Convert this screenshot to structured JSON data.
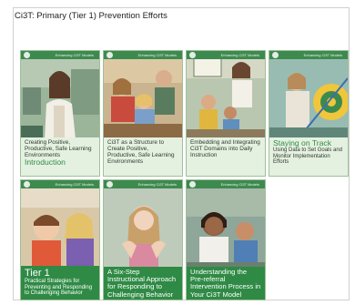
{
  "page": {
    "title": "Ci3T: Primary (Tier 1) Prevention Efforts",
    "brand": "Enhancing Ci3T Models"
  },
  "cards": [
    {
      "title": "Creating Positive, Productive, Safe Learning Environments",
      "subtitle": "Introduction"
    },
    {
      "title": "Ci3T as a Structure to Create Positive, Productive, Safe Learning Environments"
    },
    {
      "title": "Embedding and Integrating Ci3T Domains into Daily Instruction"
    },
    {
      "heading": "Staying on Track",
      "subtitle": "Using Data to Set Goals and Monitor Implementation Efforts"
    },
    {
      "heading": "Tier 1",
      "subtitle": "Practical Strategies for Preventing and Responding to Challenging Behavior"
    },
    {
      "title": "A Six-Step Instructional Approach for Responding to Challenging Behavior"
    },
    {
      "title": "Understanding the Pre-referral Intervention Process in Your Ci3T Model"
    }
  ],
  "colors": {
    "accent_green": "#2f8a45",
    "light_green": "#e4f1e0",
    "band_green": "#3d8a4f"
  }
}
